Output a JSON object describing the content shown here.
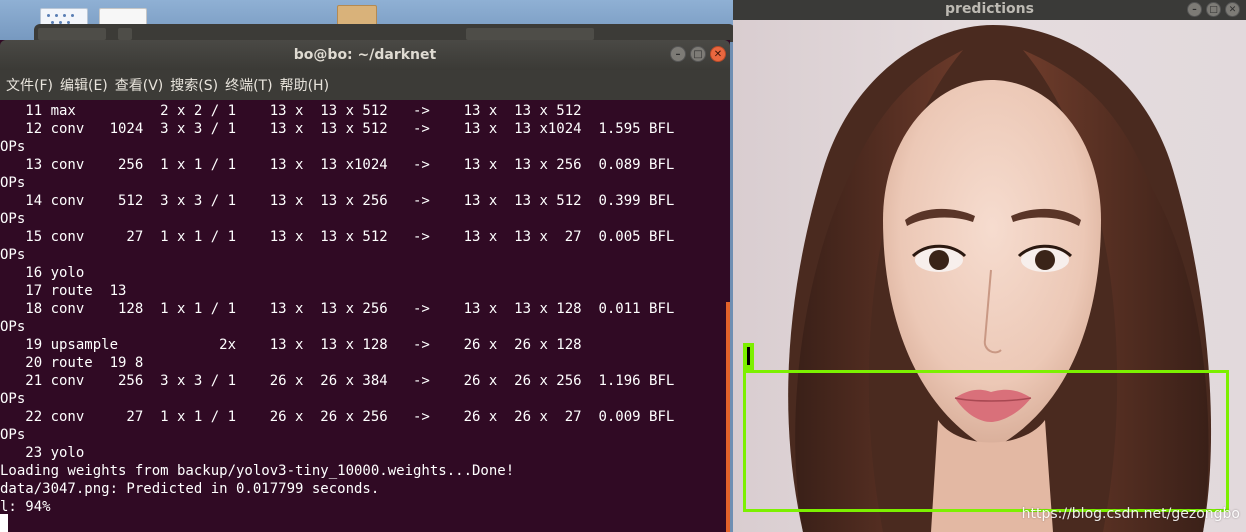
{
  "terminal": {
    "title": "bo@bo: ~/darknet",
    "menu": [
      "文件(F)",
      "编辑(E)",
      "查看(V)",
      "搜索(S)",
      "终端(T)",
      "帮助(H)"
    ],
    "lines": [
      "   11 max          2 x 2 / 1    13 x  13 x 512   ->    13 x  13 x 512",
      "   12 conv   1024  3 x 3 / 1    13 x  13 x 512   ->    13 x  13 x1024  1.595 BFL",
      "OPs",
      "   13 conv    256  1 x 1 / 1    13 x  13 x1024   ->    13 x  13 x 256  0.089 BFL",
      "OPs",
      "   14 conv    512  3 x 3 / 1    13 x  13 x 256   ->    13 x  13 x 512  0.399 BFL",
      "OPs",
      "   15 conv     27  1 x 1 / 1    13 x  13 x 512   ->    13 x  13 x  27  0.005 BFL",
      "OPs",
      "   16 yolo",
      "   17 route  13",
      "   18 conv    128  1 x 1 / 1    13 x  13 x 256   ->    13 x  13 x 128  0.011 BFL",
      "OPs",
      "   19 upsample            2x    13 x  13 x 128   ->    26 x  26 x 128",
      "   20 route  19 8",
      "   21 conv    256  3 x 3 / 1    26 x  26 x 384   ->    26 x  26 x 256  1.196 BFL",
      "OPs",
      "   22 conv     27  1 x 1 / 1    26 x  26 x 256   ->    26 x  26 x  27  0.009 BFL",
      "OPs",
      "   23 yolo",
      "Loading weights from backup/yolov3-tiny_10000.weights...Done!",
      "data/3047.png: Predicted in 0.017799 seconds.",
      "l: 94%"
    ],
    "window_buttons": [
      "minimize-icon",
      "maximize-icon",
      "close-icon"
    ]
  },
  "predictions": {
    "title": "predictions",
    "box_color": "#7cf000",
    "watermark": "https://blog.csdn.net/gezongbo"
  },
  "colors": {
    "terminal_bg": "#300a24",
    "titlebar_bg": "#3c3b37",
    "close_button": "#e9673f"
  }
}
